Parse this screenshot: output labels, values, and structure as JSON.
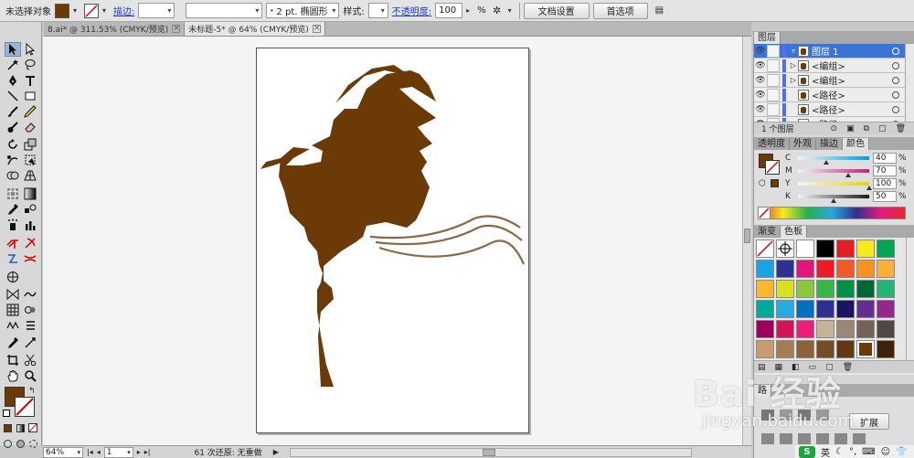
{
  "control_bar": {
    "selection_label": "未选择对象",
    "fill_color": "#6c3a07",
    "stroke_label": "描边:",
    "brush_value": "2 pt. 椭圆形",
    "style_label": "样式:",
    "opacity_label": "不透明度:",
    "opacity_value": "100",
    "opacity_unit": "%",
    "doc_setup_button": "文档设置",
    "preferences_button": "首选项"
  },
  "tabs": [
    {
      "label": "8.ai* @ 311.53% (CMYK/预览)",
      "close": "⊠"
    },
    {
      "label": "未标题-5* @ 64% (CMYK/预览)",
      "close": "⊠"
    }
  ],
  "canvas": {
    "artwork_color": "#6c3a07",
    "scarf_color": "#8a6a4a"
  },
  "status_bar": {
    "zoom": "64%",
    "page": "1",
    "undo_text": "61 次还原: 无重做"
  },
  "layers_panel": {
    "title": "图层",
    "rows": [
      {
        "name": "图层 1",
        "selected": true
      },
      {
        "name": "<编组>",
        "selected": false
      },
      {
        "name": "<编组>",
        "selected": false
      },
      {
        "name": "<路径>",
        "selected": false
      },
      {
        "name": "<路径>",
        "selected": false
      },
      {
        "name": "<路径>",
        "selected": false
      }
    ],
    "footer": "1 个图层"
  },
  "color_panel": {
    "tabs": [
      "透明度",
      "外观",
      "描边",
      "颜色"
    ],
    "active_tab": "颜色",
    "channels": [
      {
        "label": "C",
        "value": "40",
        "unit": "%",
        "fraction": 0.4,
        "from": "#f4f4f4",
        "to": "#009fe3"
      },
      {
        "label": "M",
        "value": "70",
        "unit": "%",
        "fraction": 0.7,
        "from": "#f4f4f4",
        "to": "#c2217f"
      },
      {
        "label": "Y",
        "value": "100",
        "unit": "%",
        "fraction": 1.0,
        "from": "#f4f4f4",
        "to": "#e8d500"
      },
      {
        "label": "K",
        "value": "50",
        "unit": "%",
        "fraction": 0.5,
        "from": "#f4f4f4",
        "to": "#1a1a1a"
      }
    ]
  },
  "swatches_panel": {
    "tabs": [
      "渐变",
      "色板"
    ],
    "active_tab": "色板",
    "colors": [
      "none",
      "registration",
      "#ffffff",
      "#000000",
      "#e51e25",
      "#f7ea1c",
      "#00a551",
      "#1aa2e6",
      "#2e3192",
      "#e4147f",
      "#ed1c24",
      "#f15a24",
      "#f7931e",
      "#fbb03b",
      "#fcb630",
      "#d9e021",
      "#8cc63f",
      "#39b54a",
      "#009245",
      "#006837",
      "#22b573",
      "#00a99d",
      "#29abe2",
      "#0071bc",
      "#2e3192",
      "#1b1464",
      "#662d91",
      "#93278f",
      "#9e005d",
      "#d4145a",
      "#ed1e79",
      "#c7b299",
      "#998675",
      "#736357",
      "#534741",
      "#c69c6d",
      "#a67c52",
      "#8c6239",
      "#754c24",
      "#603813",
      "#6c3a07",
      "#42210b"
    ]
  },
  "lower_panel": {
    "label": "路",
    "button": "扩展"
  },
  "watermark": {
    "brand": "Bai 经验",
    "url": "jingyan.baidu.com"
  },
  "ime": {
    "badge": "S",
    "lang": "英"
  }
}
